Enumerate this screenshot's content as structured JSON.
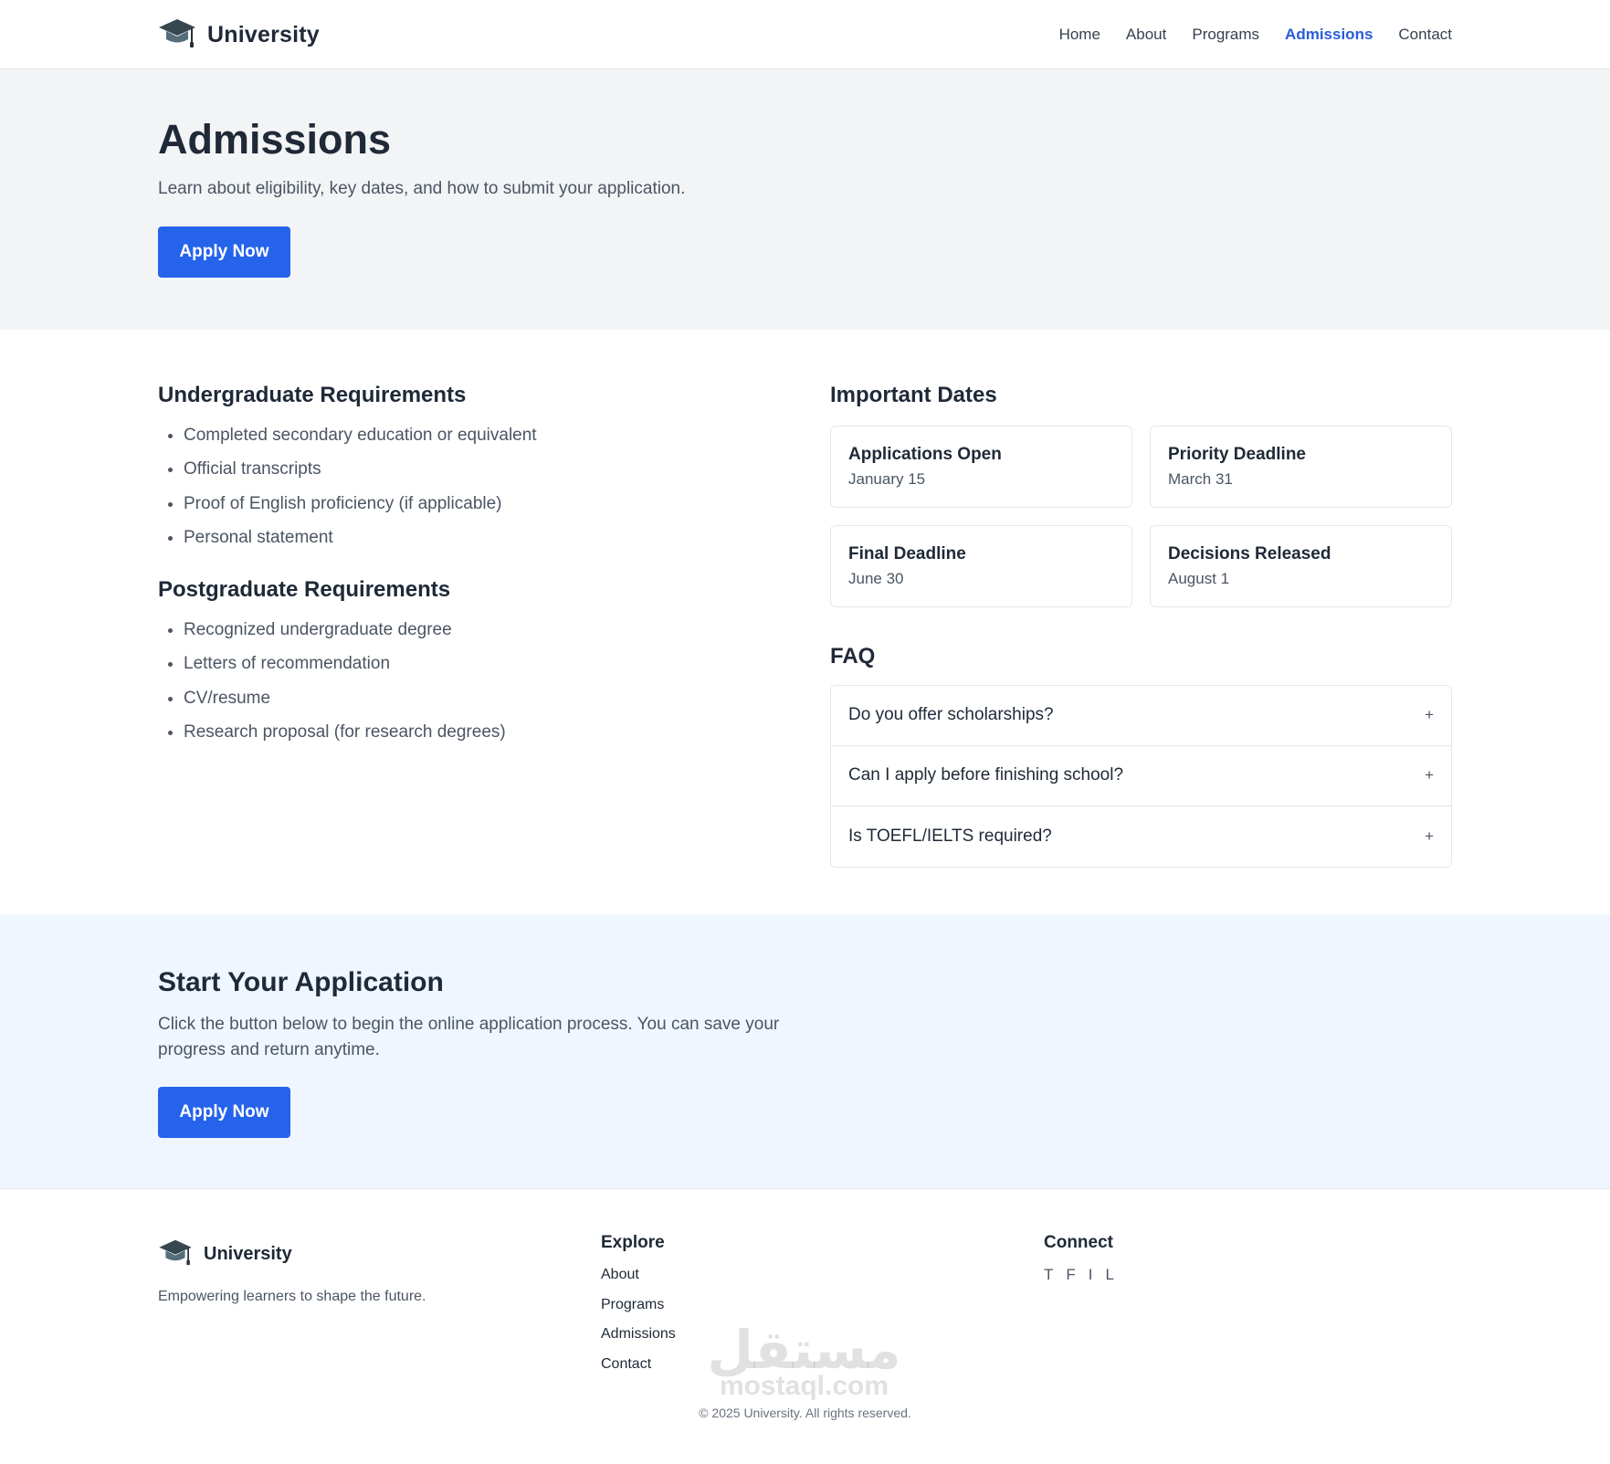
{
  "header": {
    "brand": "University",
    "nav": [
      "Home",
      "About",
      "Programs",
      "Admissions",
      "Contact"
    ],
    "active_nav": "Admissions"
  },
  "hero": {
    "title": "Admissions",
    "subtitle": "Learn about eligibility, key dates, and how to submit your application.",
    "button": "Apply Now"
  },
  "undergrad": {
    "title": "Undergraduate Requirements",
    "items": [
      "Completed secondary education or equivalent",
      "Official transcripts",
      "Proof of English proficiency (if applicable)",
      "Personal statement"
    ]
  },
  "postgrad": {
    "title": "Postgraduate Requirements",
    "items": [
      "Recognized undergraduate degree",
      "Letters of recommendation",
      "CV/resume",
      "Research proposal (for research degrees)"
    ]
  },
  "dates": {
    "title": "Important Dates",
    "cards": [
      {
        "label": "Applications Open",
        "value": "January 15"
      },
      {
        "label": "Priority Deadline",
        "value": "March 31"
      },
      {
        "label": "Final Deadline",
        "value": "June 30"
      },
      {
        "label": "Decisions Released",
        "value": "August 1"
      }
    ]
  },
  "faq": {
    "title": "FAQ",
    "items": [
      {
        "q": "Do you offer scholarships?",
        "icon": "+"
      },
      {
        "q": "Can I apply before finishing school?",
        "icon": "+"
      },
      {
        "q": "Is TOEFL/IELTS required?",
        "icon": "+"
      }
    ]
  },
  "cta": {
    "title": "Start Your Application",
    "text": "Click the button below to begin the online application process. You can save your progress and return anytime.",
    "button": "Apply Now"
  },
  "footer": {
    "brand": "University",
    "tagline": "Empowering learners to shape the future.",
    "explore_title": "Explore",
    "explore_links": [
      "About",
      "Programs",
      "Admissions",
      "Contact"
    ],
    "connect_title": "Connect",
    "socials": [
      "T",
      "F",
      "I",
      "L"
    ],
    "copyright": "© 2025 University. All rights reserved."
  },
  "watermark": {
    "mark": "مستقل",
    "text": "mostaql.com"
  },
  "colors": {
    "accent": "#2563eb",
    "nav_active": "#2a5bd7",
    "hero_bg": "#f3f4f6",
    "cta_bg": "#eff6ff",
    "text_dark": "#1f2937",
    "text_muted": "#4b5563"
  },
  "icons": {
    "logo": "graduation-cap-icon",
    "faq_toggle": "plus-icon"
  }
}
